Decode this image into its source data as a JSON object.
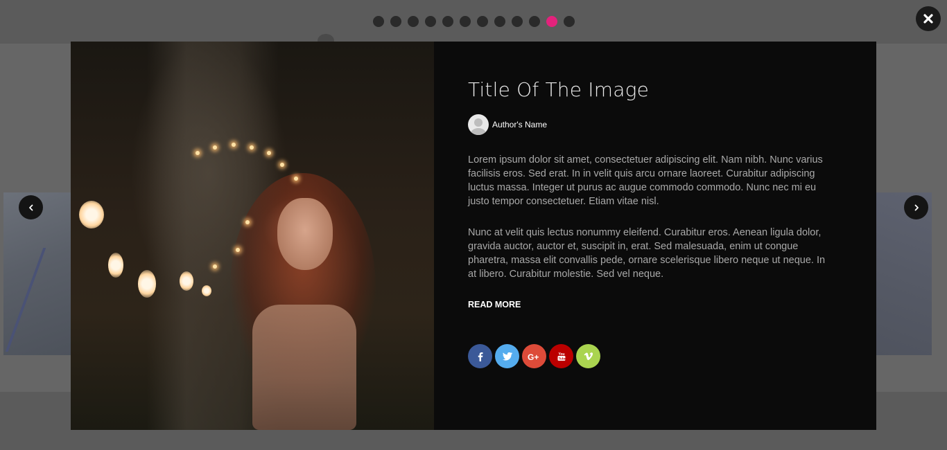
{
  "pagination": {
    "count": 12,
    "active_index": 10,
    "active_color": "#e3227c",
    "inactive_color": "#2a2a2a"
  },
  "close": {
    "icon": "close-icon"
  },
  "slider": {
    "prev_icon": "chevron-left-icon",
    "next_icon": "chevron-right-icon"
  },
  "modal": {
    "title": "Title Of The Image",
    "author": {
      "name": "Author's Name",
      "avatar_icon": "user-avatar-icon"
    },
    "paragraphs": [
      "Lorem ipsum dolor sit amet, consectetuer adipiscing elit. Nam nibh. Nunc varius facilisis eros. Sed erat. In in velit quis arcu ornare laoreet. Curabitur adipiscing luctus massa. Integer ut purus ac augue commodo commodo. Nunc nec mi eu justo tempor consectetuer. Etiam vitae nisl.",
      "Nunc at velit quis lectus nonummy eleifend. Curabitur eros. Aenean ligula dolor, gravida auctor, auctor et, suscipit in, erat. Sed malesuada, enim ut congue pharetra, massa elit convallis pede, ornare scelerisque libero neque ut neque. In at libero. Curabitur molestie. Sed vel neque."
    ],
    "read_more": "READ MORE",
    "social": [
      {
        "name": "facebook",
        "icon": "facebook-icon",
        "color": "#3b5998"
      },
      {
        "name": "twitter",
        "icon": "twitter-icon",
        "color": "#55acee"
      },
      {
        "name": "google-plus",
        "icon": "google-plus-icon",
        "color": "#dd4b39"
      },
      {
        "name": "youtube",
        "icon": "youtube-icon",
        "color": "#bb0000"
      },
      {
        "name": "vimeo",
        "icon": "vimeo-icon",
        "color": "#aad450"
      }
    ]
  }
}
